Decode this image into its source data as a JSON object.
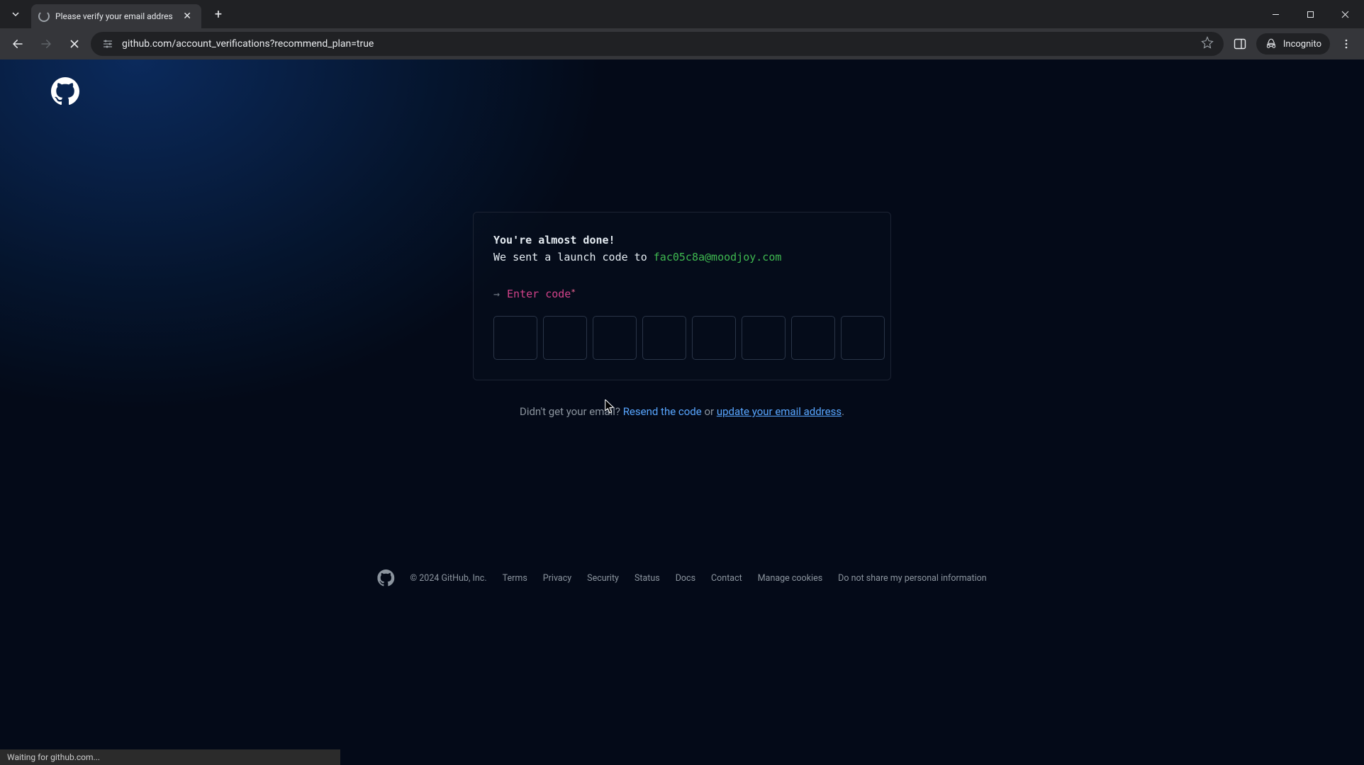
{
  "browser": {
    "tab_title": "Please verify your email addres",
    "url": "github.com/account_verifications?recommend_plan=true",
    "incognito_label": "Incognito",
    "status_text": "Waiting for github.com..."
  },
  "card": {
    "line1": "You're almost done!",
    "line2_prefix": "We sent a launch code to ",
    "email": "fac05c8a@moodjoy.com",
    "enter_label": "Enter code",
    "code_digits": 8
  },
  "resend": {
    "prefix": "Didn't get your email? ",
    "resend_label": "Resend the code",
    "or": " or ",
    "update_label": "update your email address",
    "period": "."
  },
  "footer": {
    "copyright": "© 2024 GitHub, Inc.",
    "links": [
      "Terms",
      "Privacy",
      "Security",
      "Status",
      "Docs",
      "Contact",
      "Manage cookies",
      "Do not share my personal information"
    ]
  }
}
